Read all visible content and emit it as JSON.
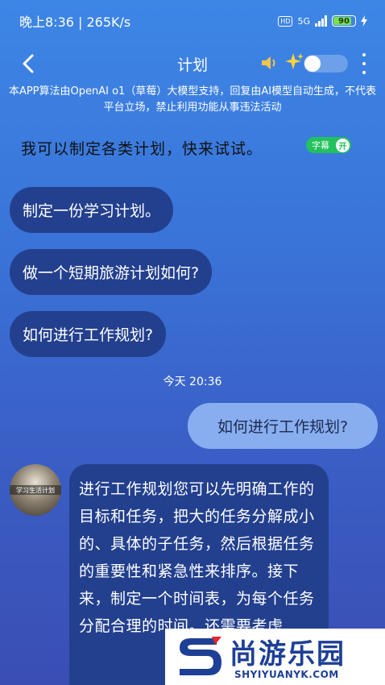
{
  "status_bar": {
    "time_speed": "晚上8:36 | 265K/s",
    "hd": "HD",
    "network": "5G",
    "battery": "90"
  },
  "nav": {
    "title": "计划",
    "icons": [
      "back-arrow-icon",
      "speaker-icon",
      "sparkle-icon",
      "toggle-switch",
      "more-icon"
    ]
  },
  "disclaimer": "本APP算法由OpenAI o1（草莓）大模型支持，回复由AI模型自动生成，不代表平台立场，禁止利用功能从事违法活动",
  "intro": {
    "text": "我可以制定各类计划，快来试试。",
    "subtitle_label": "字幕",
    "subtitle_state": "开"
  },
  "suggestions": [
    "制定一份学习计划。",
    "做一个短期旅游计划如何?",
    "如何进行工作规划?"
  ],
  "chat": {
    "time": "今天 20:36",
    "user_message": "如何进行工作规划?",
    "avatar_label": "学习生活计划",
    "ai_message": "进行工作规划您可以先明确工作的目标和任务，把大的任务分解成小的、具体的子任务，然后根据任务的重要性和紧急性来排序。接下来，制定一个时间表，为每个任务分配合理的时间。还需要考虑"
  },
  "watermark": {
    "name": "尚游乐园",
    "url": "SHYIYUANYK.COM"
  },
  "colors": {
    "bg_top": "#3d86e6",
    "bubble_dark": "#23408e",
    "bubble_user": "#88aef0",
    "subtitle_green": "#22c15e",
    "brand_blue": "#1d3f96"
  }
}
